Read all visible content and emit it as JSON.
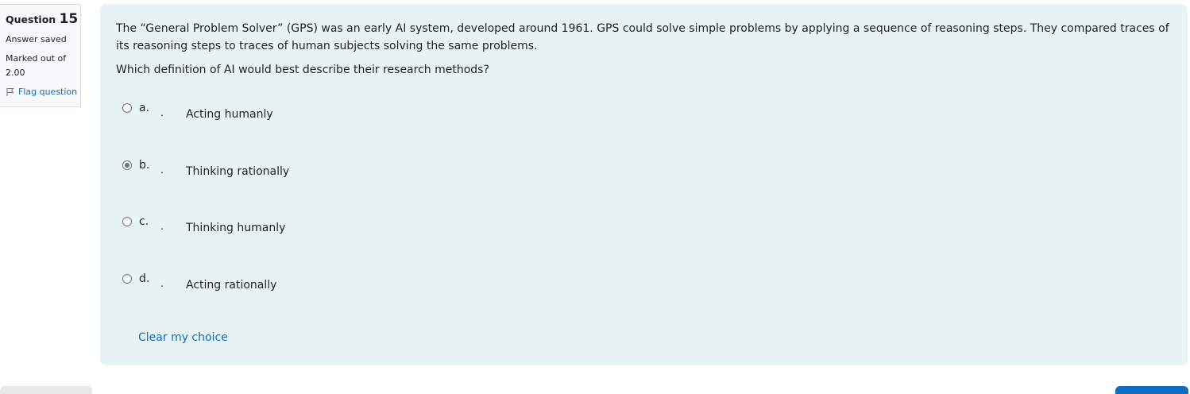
{
  "question_info": {
    "label": "Question",
    "number": "15",
    "state": "Answer saved",
    "grade": "Marked out of 2.00",
    "flag_label": "Flag question"
  },
  "question_text": {
    "paragraph1": "The “General Problem Solver” (GPS) was an early AI system, developed around 1961. GPS could solve simple problems by applying a sequence of reasoning steps. They compared traces of its reasoning steps to traces of human subjects solving the same problems.",
    "paragraph2": "Which definition of AI would best describe their research methods?"
  },
  "answers": [
    {
      "letter": "a.",
      "separator": ".",
      "text": "Acting humanly",
      "selected": false
    },
    {
      "letter": "b.",
      "separator": ".",
      "text": "Thinking rationally",
      "selected": true
    },
    {
      "letter": "c.",
      "separator": ".",
      "text": "Thinking humanly",
      "selected": false
    },
    {
      "letter": "d.",
      "separator": ".",
      "text": "Acting rationally",
      "selected": false
    }
  ],
  "clear_choice_label": "Clear my choice",
  "colors": {
    "content_background": "#e7f3f5",
    "link": "#0f6cbf",
    "info_background": "#f8f9fa"
  },
  "icons": {
    "flag": "flag-icon"
  }
}
